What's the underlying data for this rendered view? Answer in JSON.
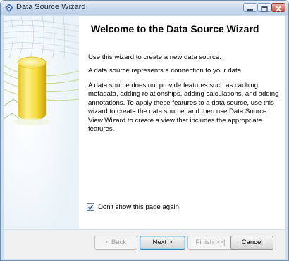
{
  "window": {
    "title": "Data Source Wizard"
  },
  "wizard": {
    "heading": "Welcome to the Data Source Wizard",
    "paragraphs": [
      "Use this wizard to create a new data source.",
      "A data source represents a connection to your data.",
      "A data source does not provide features such as caching metadata, adding relationships, adding calculations, and adding annotations. To apply these features to a data source, use this wizard to create the data source, and then use Data Source View Wizard to create a view that includes the appropriate features."
    ],
    "dont_show": {
      "label": "Don't show this page again",
      "checked": true
    }
  },
  "buttons": {
    "back": {
      "label": "< Back",
      "enabled": false
    },
    "next": {
      "label": "Next >",
      "enabled": true
    },
    "finish": {
      "label": "Finish >>|",
      "enabled": false
    },
    "cancel": {
      "label": "Cancel",
      "enabled": true
    }
  },
  "icons": {
    "app": "wizard-app-icon",
    "side_art": "database-cylinder-icon",
    "minimize": "minimize-icon",
    "maximize": "maximize-icon",
    "close": "close-icon",
    "checkbox": "checkmark-icon"
  },
  "colors": {
    "title_bar": "#c9daee",
    "cylinder": "#f2dc3c",
    "button_bar": "#f0f0f0",
    "close_button": "#c95a48"
  }
}
